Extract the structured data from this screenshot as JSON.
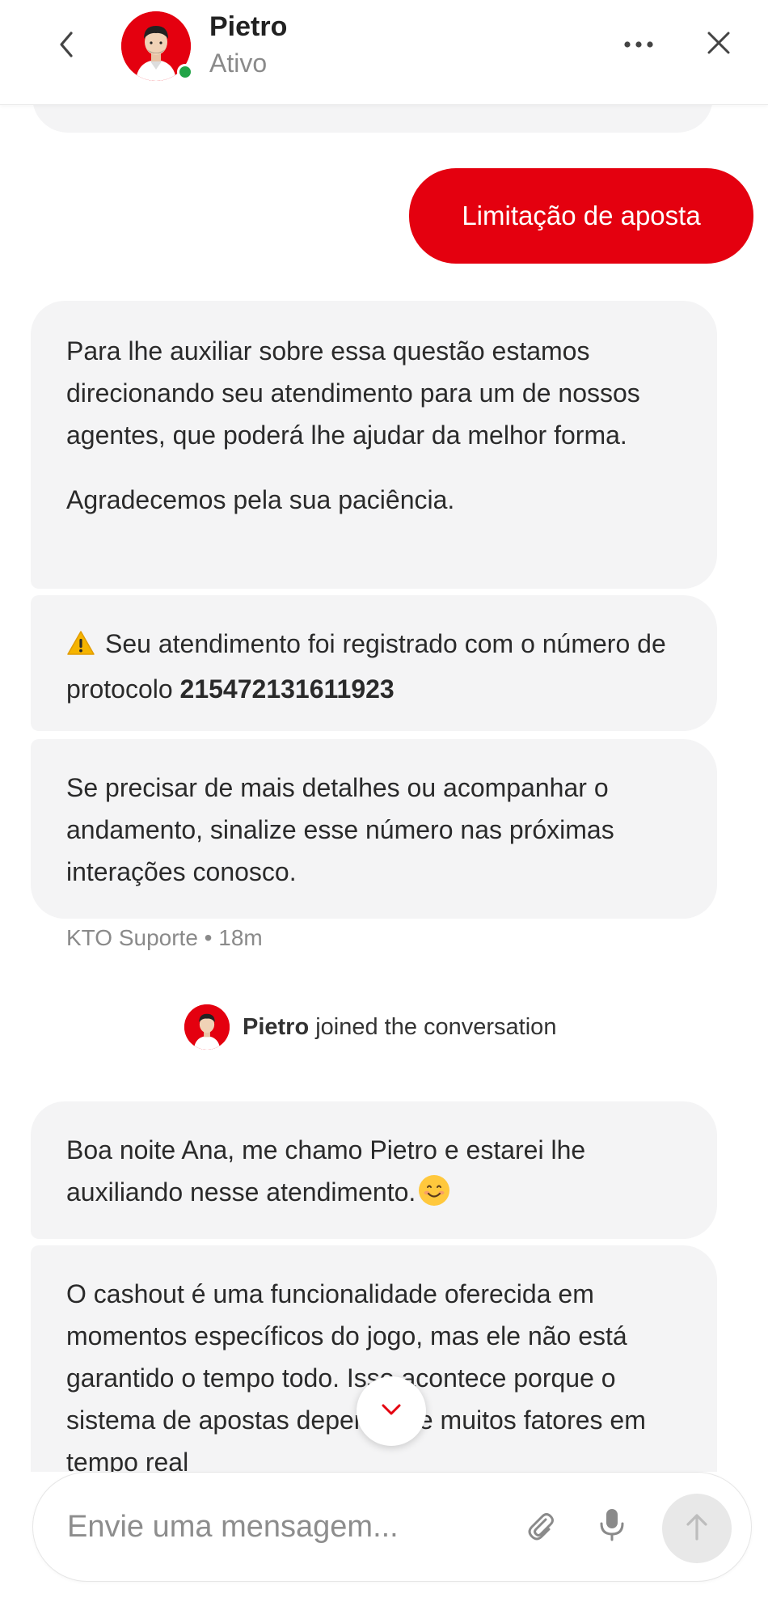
{
  "header": {
    "name": "Pietro",
    "status": "Ativo"
  },
  "messages": {
    "user_request": "Limitação de aposta",
    "bot_1_p1": "Para lhe auxiliar sobre essa questão estamos direcionando seu atendimento para um de nossos agentes, que poderá lhe ajudar da melhor forma.",
    "bot_1_p2": "Agradecemos pela sua paciência.",
    "bot_2_text": "Seu atendimento foi registrado com o número de protocolo",
    "bot_2_protocol": "215472131611923",
    "bot_3_text": "Se precisar de mais detalhes ou acompanhar o andamento, sinalize esse número nas próximas interações conosco.",
    "bot_meta": "KTO Suporte • 18m",
    "agent_greeting": "Boa noite Ana, me chamo Pietro e estarei lhe auxiliando nesse atendimento.",
    "agent_message_2": "O cashout é uma funcionalidade oferecida em momentos específicos do jogo, mas ele não está garantido o tempo todo. Isso acontece porque o sistema de apostas depende de muitos fatores em tempo real"
  },
  "joined_event": {
    "name": "Pietro",
    "text": "joined the conversation"
  },
  "composer": {
    "placeholder": "Envie uma mensagem..."
  },
  "icons": {
    "back": "chevron-left-icon",
    "more": "more-horizontal-icon",
    "close": "close-icon",
    "warning": "warning-icon",
    "emoji": "smiling-face-icon",
    "scroll": "chevron-down-icon",
    "attach": "paperclip-icon",
    "mic": "microphone-icon",
    "send": "arrow-up-icon"
  },
  "colors": {
    "brand_red": "#e4000f",
    "bubble_gray": "#f4f4f5",
    "online_green": "#22a447"
  }
}
